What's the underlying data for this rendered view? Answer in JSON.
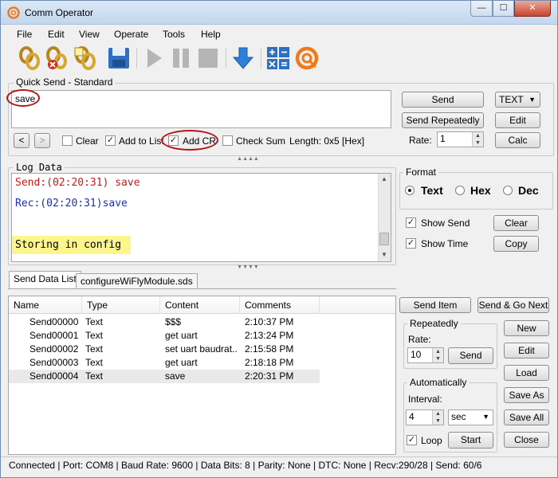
{
  "window": {
    "title": "Comm Operator",
    "min": "—",
    "max": "☐",
    "close": "✕"
  },
  "menu": [
    "File",
    "Edit",
    "View",
    "Operate",
    "Tools",
    "Help"
  ],
  "toolbar": {
    "icons": [
      "connect-icon",
      "disconnect-icon",
      "connect-settings-icon",
      "save-icon",
      "play-icon",
      "pause-icon",
      "stop-icon",
      "download-icon",
      "calculator-icon",
      "app-logo-icon"
    ]
  },
  "quick_send": {
    "title": "Quick Send - Standard",
    "text": "save",
    "send": "Send",
    "send_repeatedly": "Send Repeatedly",
    "format": "TEXT",
    "edit": "Edit",
    "rate_label": "Rate:",
    "rate_value": "1",
    "calc": "Calc",
    "prev": "<",
    "next": ">",
    "clear": "Clear",
    "add_to_list": "Add to List",
    "add_cr": "Add CR",
    "check_sum": "Check Sum",
    "length": "Length: 0x5 [Hex]"
  },
  "log": {
    "title": "Log Data",
    "lines": [
      {
        "text": "Send:(02:20:31) save",
        "color": "#c8181b"
      },
      {
        "text": "Rec:(02:20:31)save",
        "color": "#1b2fbf"
      },
      {
        "text": "Storing in config",
        "color": "#000000",
        "highlight": "#fdf68a"
      }
    ]
  },
  "format_panel": {
    "title": "Format",
    "options": [
      "Text",
      "Hex",
      "Dec"
    ],
    "selected": "Text",
    "show_send": "Show Send",
    "show_time": "Show Time",
    "clear": "Clear",
    "copy": "Copy"
  },
  "tabs": [
    "Send Data List",
    "configureWiFlyModule.sds"
  ],
  "table": {
    "columns": [
      "Name",
      "Type",
      "Content",
      "Comments"
    ],
    "rows": [
      [
        "Send00000",
        "Text",
        "$$$",
        "2:10:37 PM"
      ],
      [
        "Send00001",
        "Text",
        "get uart",
        "2:13:24 PM"
      ],
      [
        "Send00002",
        "Text",
        "set uart baudrat...",
        "2:15:58 PM"
      ],
      [
        "Send00003",
        "Text",
        "get uart",
        "2:18:18 PM"
      ],
      [
        "Send00004",
        "Text",
        "save",
        "2:20:31 PM"
      ]
    ],
    "selected_row": 4
  },
  "list_panel": {
    "send_item": "Send Item",
    "send_go_next": "Send & Go Next",
    "repeatedly": "Repeatedly",
    "rate_label": "Rate:",
    "rate_value": "10",
    "send": "Send",
    "automatically": "Automatically",
    "interval_label": "Interval:",
    "interval_value": "4",
    "interval_unit": "sec",
    "loop": "Loop",
    "start": "Start",
    "new": "New",
    "edit": "Edit",
    "load": "Load",
    "save_as": "Save As",
    "save_all": "Save All",
    "close": "Close"
  },
  "status": "Connected | Port: COM8 | Baud Rate: 9600 | Data Bits: 8 | Parity: None | DTC: None | Recv:290/28 | Send: 60/6"
}
